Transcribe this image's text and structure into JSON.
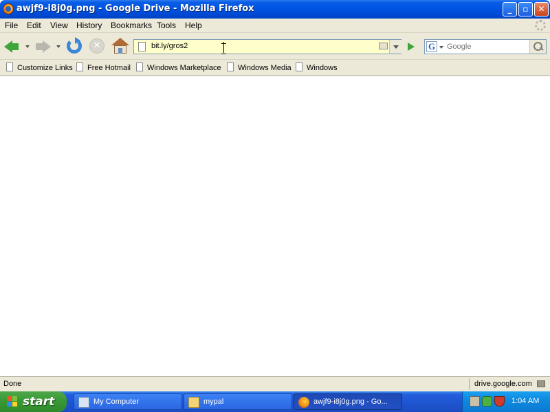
{
  "window": {
    "title": "awjf9-i8j0g.png - Google Drive - Mozilla Firefox",
    "minimize_glyph": "_",
    "maximize_glyph": "▫",
    "close_glyph": "✕"
  },
  "menu": {
    "items": [
      {
        "label": "File"
      },
      {
        "label": "Edit"
      },
      {
        "label": "View"
      },
      {
        "label": "History"
      },
      {
        "label": "Bookmarks"
      },
      {
        "label": "Tools"
      },
      {
        "label": "Help"
      }
    ]
  },
  "toolbar": {
    "back_icon": "back-arrow-icon",
    "forward_icon": "forward-arrow-icon",
    "reload_icon": "reload-icon",
    "stop_icon": "stop-icon",
    "stop_glyph": "✕",
    "home_icon": "home-icon",
    "url": "bit.ly/gros2",
    "go_icon": "go-arrow-icon"
  },
  "search": {
    "engine_letter": "G",
    "placeholder": "Google"
  },
  "bookmarks": {
    "items": [
      {
        "label": "Customize Links"
      },
      {
        "label": "Free Hotmail"
      },
      {
        "label": "Windows Marketplace"
      },
      {
        "label": "Windows Media"
      },
      {
        "label": "Windows"
      }
    ]
  },
  "status": {
    "left": "Done",
    "right": "drive.google.com"
  },
  "taskbar": {
    "start_label": "start",
    "tasks": [
      {
        "label": "My Computer",
        "icon": "computer-icon"
      },
      {
        "label": "mypal",
        "icon": "folder-icon"
      },
      {
        "label": "awjf9-i8j0g.png - Go...",
        "icon": "firefox-icon"
      }
    ],
    "clock": "1:04 AM"
  },
  "colors": {
    "titlebar": "#0054e3",
    "chrome": "#ece9d8",
    "urlbar_bg": "#ffffcc",
    "taskbar": "#245edb",
    "start_green": "#3b9a37"
  }
}
